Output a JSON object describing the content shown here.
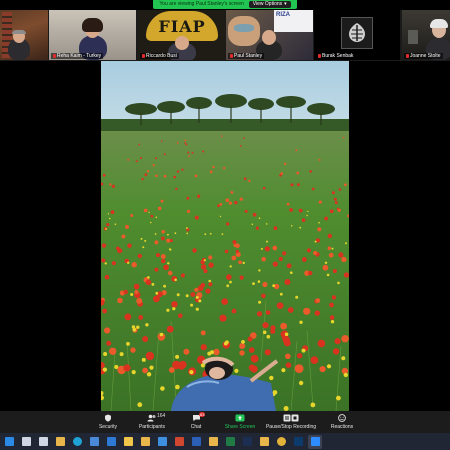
{
  "banner": {
    "viewing_text": "You are viewing Paul Stanley's screen",
    "view_options_label": "View Options"
  },
  "participants": [
    {
      "name": ""
    },
    {
      "name": "Reha Kaim - Turkey"
    },
    {
      "name": "Riccardo Busi"
    },
    {
      "name": "Paul Stanley"
    },
    {
      "name": "Burak Senbak"
    },
    {
      "name": "Joanne Stolte"
    }
  ],
  "tile_logos": {
    "fiap": "FIAP",
    "riza": "RIZA"
  },
  "toolbar": {
    "security_label": "Security",
    "participants_label": "Participants",
    "participants_count": "164",
    "chat_label": "Chat",
    "chat_badge": "83",
    "share_label": "Share Screen",
    "record_label": "Pause/Stop Recording",
    "reactions_label": "Reactions"
  },
  "colors": {
    "banner_green": "#23c552",
    "share_green": "#24c65a",
    "mute_red": "#e02b2b",
    "toolbar_bg": "#1c1c1c",
    "taskbar_bg": "#202634"
  },
  "taskbar_icons": [
    "windows-icon",
    "task-view-icon",
    "search-icon",
    "app-icon",
    "edge-icon",
    "store-icon",
    "mail-icon",
    "files-icon",
    "app-icon",
    "photos-icon",
    "powerpoint-icon",
    "word-icon",
    "app-icon",
    "excel-icon",
    "lightroom-icon",
    "app-icon",
    "chrome-icon",
    "photoshop-icon",
    "zoom-icon"
  ]
}
